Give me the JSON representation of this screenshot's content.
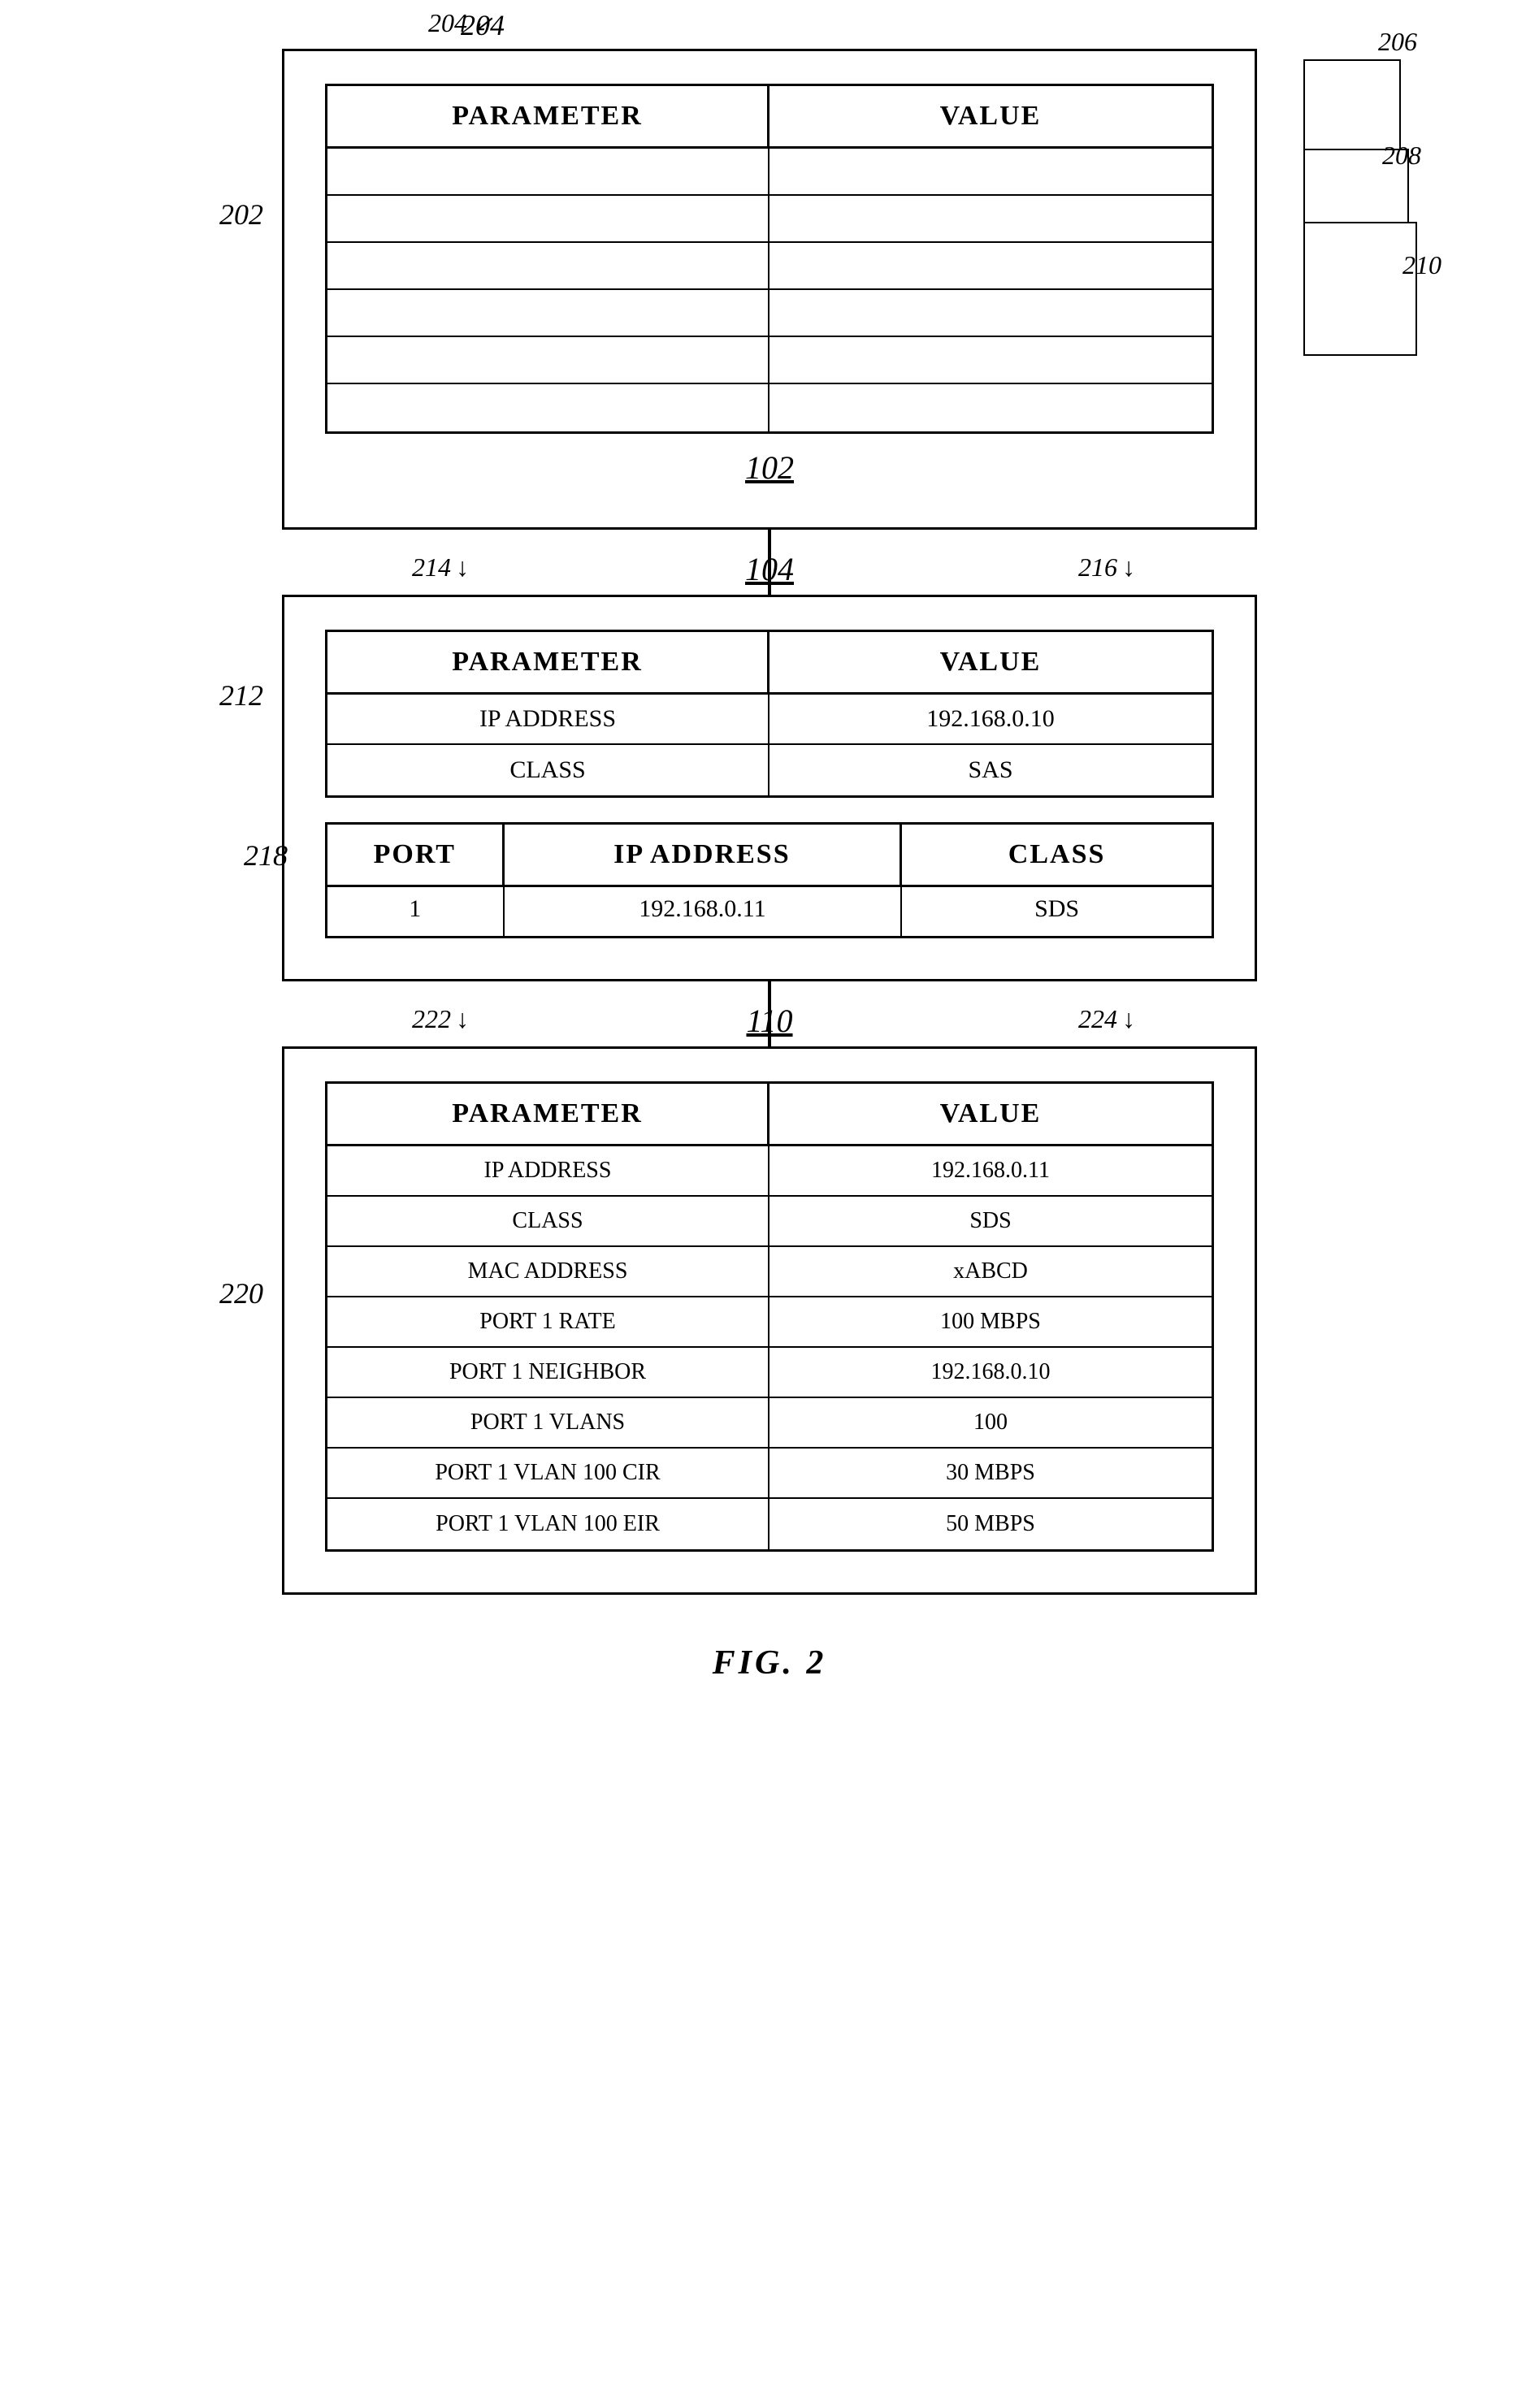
{
  "diagram": {
    "top_box": {
      "label_ref": "202",
      "label_group_ref": "204",
      "label_bottom_ref": "102",
      "right_pages": [
        "206",
        "208",
        "210"
      ],
      "header": {
        "param": "PARAMETER",
        "value": "VALUE"
      },
      "rows": [
        {
          "param": "",
          "value": ""
        },
        {
          "param": "",
          "value": ""
        },
        {
          "param": "",
          "value": ""
        },
        {
          "param": "",
          "value": ""
        },
        {
          "param": "",
          "value": ""
        },
        {
          "param": "",
          "value": ""
        }
      ]
    },
    "middle_box": {
      "label_ref": "212",
      "label_group_ref": "104",
      "label_param_ref": "214",
      "label_value_ref": "216",
      "label_bottom_ref": "218",
      "top_table": {
        "header": {
          "param": "PARAMETER",
          "value": "VALUE"
        },
        "rows": [
          {
            "param": "IP  ADDRESS",
            "value": "192.168.0.10"
          },
          {
            "param": "CLASS",
            "value": "SAS"
          }
        ]
      },
      "bottom_table": {
        "headers": {
          "port": "PORT",
          "ip_address": "IP  ADDRESS",
          "class": "CLASS"
        },
        "rows": [
          {
            "port": "1",
            "ip_address": "192.168.0.11",
            "class": "SDS"
          }
        ]
      }
    },
    "bottom_box": {
      "label_ref": "220",
      "label_group_ref": "110",
      "label_param_ref": "222",
      "label_value_ref": "224",
      "table": {
        "header": {
          "param": "PARAMETER",
          "value": "VALUE"
        },
        "rows": [
          {
            "param": "IP  ADDRESS",
            "value": "192.168.0.11"
          },
          {
            "param": "CLASS",
            "value": "SDS"
          },
          {
            "param": "MAC  ADDRESS",
            "value": "xABCD"
          },
          {
            "param": "PORT  1  RATE",
            "value": "100  MBPS"
          },
          {
            "param": "PORT  1  NEIGHBOR",
            "value": "192.168.0.10"
          },
          {
            "param": "PORT  1  VLANS",
            "value": "100"
          },
          {
            "param": "PORT  1  VLAN  100  CIR",
            "value": "30  MBPS"
          },
          {
            "param": "PORT  1  VLAN  100  EIR",
            "value": "50  MBPS"
          }
        ]
      }
    },
    "figure_label": "FIG. 2"
  }
}
